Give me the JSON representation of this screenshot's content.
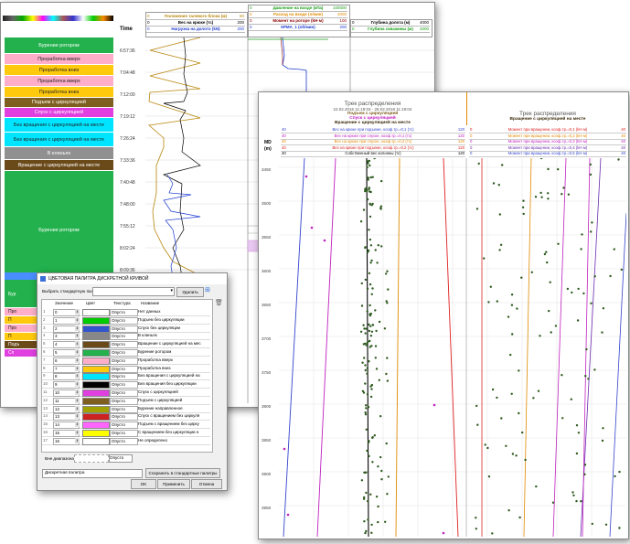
{
  "back_window": {
    "time_header": "Time",
    "legend_left": [
      {
        "label": "Положение талевого блока (м)",
        "max": "50",
        "color": "#b8860b"
      },
      {
        "label": "Вес на крюке (тс)",
        "max": "200",
        "color": "#000000"
      },
      {
        "label": "Нагрузка на долото (kN)",
        "max": "200",
        "color": "#1e3cd0"
      }
    ],
    "legend_mid": [
      {
        "label": "Давление на входе (кПа)",
        "max": "100000",
        "color": "#1a9e1a"
      },
      {
        "label": "Расход на входе (л/мин)",
        "max": "4000",
        "color": "#e08a00"
      },
      {
        "label": "Момент на роторе (kH·м)",
        "max": "100",
        "color": "#8b0000"
      },
      {
        "label": "КРМА_1 (об/мин)",
        "max": "200",
        "color": "#1e3cd0"
      }
    ],
    "legend_right": [
      {
        "label": "Глубина долота (м)",
        "max": "4000",
        "color": "#000000"
      },
      {
        "label": "Глубина скважины (м)",
        "max": "4000",
        "color": "#1a9e1a"
      }
    ],
    "times": [
      "6:57:36",
      "7:04:48",
      "7:12:00",
      "7:19:12",
      "7:26:24",
      "7:33:36",
      "7:40:48",
      "7:48:00",
      "7:55:12",
      "8:02:24",
      "8:09:36"
    ],
    "activities": [
      {
        "label": "Бурение ротором",
        "color": "#22b14c",
        "text_color": "#ffffff"
      },
      {
        "label": "Проработка вверх",
        "color": "#ffaec9",
        "text_color": "#222222"
      },
      {
        "label": "Проработка вниз",
        "color": "#ffc90e",
        "text_color": "#222222"
      },
      {
        "label": "Проработка вверх",
        "color": "#ffaec9",
        "text_color": "#222222"
      },
      {
        "label": "Проработка вниз",
        "color": "#ffc90e",
        "text_color": "#222222"
      },
      {
        "label": "Подъем с циркуляцией",
        "color": "#7f5f1f",
        "text_color": "#ffffff"
      },
      {
        "label": "Спуск с циркуляцией",
        "color": "#e040e0",
        "text_color": "#ffffff"
      },
      {
        "label": "Без вращения с циркуляцией на месте",
        "color": "#00e5ff",
        "text_color": "#222222"
      },
      {
        "label": "Без вращения с циркуляцией на месте",
        "color": "#00e5ff",
        "text_color": "#222222"
      },
      {
        "label": "В клиньях",
        "color": "#909090",
        "text_color": "#ffffff"
      },
      {
        "label": "Вращение с циркуляцией на месте",
        "color": "#6b4a1a",
        "text_color": "#ffffff"
      },
      {
        "label": "Бурение ротором",
        "color": "#22b14c",
        "text_color": "#ffffff"
      }
    ],
    "partial_labels": [
      "Бур",
      "Про",
      "П",
      "Про",
      "П",
      "Подъ",
      "Сп"
    ]
  },
  "dialog": {
    "title": "ЦВЕТОВАЯ ПАЛИТРА ДИСКРЕТНОЙ КРИВОЙ",
    "select_label": "Выбрать стандартную палитру:",
    "delete_button": "Удалить",
    "columns": [
      "Значение",
      "Цвет",
      "Текстура",
      "Название"
    ],
    "texture_value": "Опусто",
    "rows": [
      {
        "n": "1",
        "value": "0",
        "color": "#ffffff",
        "name": "Нет данных"
      },
      {
        "n": "2",
        "value": "1",
        "color": "#00cc00",
        "name": "Подъем без циркуляции"
      },
      {
        "n": "3",
        "value": "2",
        "color": "#3355cc",
        "name": "Спуск без циркуляции"
      },
      {
        "n": "4",
        "value": "3",
        "color": "#888888",
        "name": "В клиньях"
      },
      {
        "n": "5",
        "value": "4",
        "color": "#6b4a1a",
        "name": "Вращение с циркуляцией на мес"
      },
      {
        "n": "6",
        "value": "5",
        "color": "#22b14c",
        "name": "Бурение ротором"
      },
      {
        "n": "7",
        "value": "6",
        "color": "#ffaec9",
        "name": "Проработка вверх"
      },
      {
        "n": "8",
        "value": "7",
        "color": "#ffc90e",
        "name": "Проработка вниз"
      },
      {
        "n": "9",
        "value": "8",
        "color": "#00e5ff",
        "name": "Без вращения с циркуляцией на"
      },
      {
        "n": "10",
        "value": "9",
        "color": "#000000",
        "name": "Без вращения без циркуляции"
      },
      {
        "n": "11",
        "value": "10",
        "color": "#e040e0",
        "name": "Спуск с циркуляцией"
      },
      {
        "n": "12",
        "value": "11",
        "color": "#7f5f1f",
        "name": "Подъем с циркуляцией"
      },
      {
        "n": "13",
        "value": "12",
        "color": "#a0a000",
        "name": "Бурение направленное"
      },
      {
        "n": "14",
        "value": "13",
        "color": "#cc2222",
        "name": "Спуск с вращением без циркуля"
      },
      {
        "n": "15",
        "value": "14",
        "color": "#ff66ff",
        "name": "Подъем с вращением без цирку"
      },
      {
        "n": "16",
        "value": "15",
        "color": "#ffff00",
        "name": "С вращением без циркуляции н"
      },
      {
        "n": "17",
        "value": "16",
        "color": "#ffffff",
        "name": "Не определено"
      }
    ],
    "out_of_range_label": "Вне диапазона",
    "out_of_range_texture": "Опусто",
    "palette_name": "Дискретная палитра",
    "save_button": "Сохранить в стандартные палитры",
    "ok_button": "OK",
    "apply_button": "Применить",
    "cancel_button": "Отмена"
  },
  "front_window": {
    "title": "Трек распределения",
    "date_range": "24.02.2016 11:19:03 - 28.02.2018 11:19:04",
    "states_left": [
      {
        "label": "Подъем с циркуляцией",
        "color": "#7f5f1f"
      },
      {
        "label": "Спуск с циркуляцией",
        "color": "#c020c0"
      },
      {
        "label": "Вращение с циркуляцией на месте",
        "color": "#6b4a1a"
      }
    ],
    "right_title": "Трек распределения",
    "right_state": "Вращение с циркуляцией на месте",
    "md_label": "MD",
    "md_unit": "(m)",
    "left_legend": [
      {
        "min": "40",
        "label": "Вес на крюке при подъеме, коэф.тр.=0,1 (тс)",
        "max": "120",
        "color": "#3344cc"
      },
      {
        "min": "40",
        "label": "Вес на крюке при спуске, коэф.тр.=0,1 (тс)",
        "max": "120",
        "color": "#c020c0"
      },
      {
        "min": "40",
        "label": "Вес на крюке при спуске, коэф.тр.=0,2 (тс)",
        "max": "120",
        "color": "#e08a00"
      },
      {
        "min": "40",
        "label": "Вес на крюке при подъеме, коэф.тр.=0,2 (тс)",
        "max": "120",
        "color": "#e02020"
      },
      {
        "min": "40",
        "label": "Собственный вес колонны (тс)",
        "max": "120",
        "color": "#000000"
      }
    ],
    "right_legend": [
      {
        "min": "0",
        "label": "Момент при вращении, коэф.тр.=0,1 (kH·м)",
        "max": "40",
        "color": "#e02020"
      },
      {
        "min": "0",
        "label": "Момент при вращении, коэф.тр.=0,2 (kH·м)",
        "max": "40",
        "color": "#e08a00"
      },
      {
        "min": "0",
        "label": "Момент при вращении, коэф.тр.=0,3 (kH·м)",
        "max": "40",
        "color": "#c020c0"
      },
      {
        "min": "0",
        "label": "Момент при вращении, коэф.тр.=0,4 (kH·м)",
        "max": "40",
        "color": "#6b2ab0"
      },
      {
        "min": "0",
        "label": "Момент при вращении, коэф.тр.=0,5 (kH·м)",
        "max": "40",
        "color": "#3344cc"
      }
    ],
    "depths": [
      "3450",
      "3500",
      "3550",
      "3600",
      "3650",
      "3700",
      "3750",
      "3800",
      "3850",
      "3900",
      "3950",
      "4000"
    ]
  }
}
